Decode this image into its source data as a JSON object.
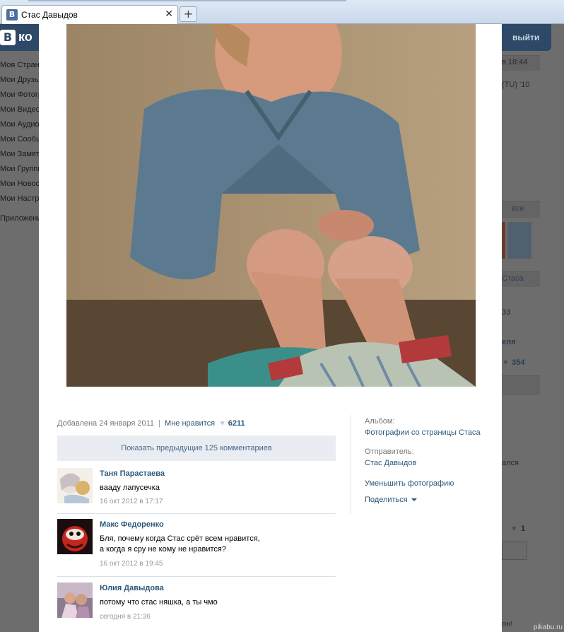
{
  "browser": {
    "tab_title": "Стас Давыдов",
    "tab_favicon": "В",
    "new_tab_glyph": "+",
    "close_glyph": "✕"
  },
  "background_page": {
    "logo_letter": "В",
    "logo_text": "ко",
    "exit_label": "выйти",
    "left_menu": [
      "Моя Страница",
      "Мои Друзья",
      "Мои Фотографии",
      "Мои Видеозаписи",
      "Мои Аудиозаписи",
      "Мои Сообщения",
      "Мои Заметки",
      "Мои Группы",
      "Мои Новости",
      "Мои Настройки"
    ],
    "apps_label": "Приложения",
    "right_fragments": {
      "time": "в 18:44",
      "edu": "(TU) '10",
      "all": "все",
      "stasa": "Стаса",
      "num33": "33",
      "nedelya": "еля",
      "likes354": "354",
      "alsya": "ался",
      "like1": "1",
      "on": "он!"
    }
  },
  "photo": {
    "alt": "photo-content"
  },
  "info": {
    "added": "Добавлена 24 января 2011",
    "separator": "|",
    "like_label": "Мне нравится",
    "like_count": "6211"
  },
  "comments_toggle": "Показать предыдущие 125 комментариев",
  "comments": [
    {
      "author": "Таня Парастаева",
      "text": "вааду лапусечка",
      "date": "16 окт 2012 в 17:17"
    },
    {
      "author": "Макс Федоренко",
      "text": "Бля, почему когда Стас срёт всем нравится,\nа когда я сру не кому не нравится?",
      "date": "16 окт 2012 в 19:45"
    },
    {
      "author": "Юлия Давыдова",
      "text": "потому что стас няшка, а ты чмо",
      "date": "сегодня в 21:36"
    }
  ],
  "side": {
    "album_label": "Альбом:",
    "album_link": "Фотографии со страницы Стаса",
    "sender_label": "Отправитель:",
    "sender_link": "Стас Давыдов",
    "shrink_link": "Уменьшить фотографию",
    "share_link": "Поделиться"
  },
  "watermark": "pikabu.ru",
  "colors": {
    "link": "#2b587a",
    "header_blue": "#2d4967",
    "toggle_bg": "#e9edf1"
  }
}
